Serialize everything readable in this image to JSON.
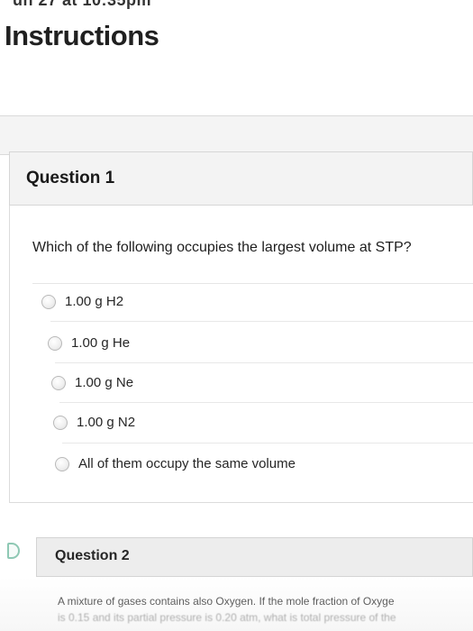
{
  "header": {
    "top_fragment": "un 27 at 10:35pm",
    "title": "Instructions"
  },
  "question1": {
    "title": "Question 1",
    "prompt": "Which of the following occupies the largest volume at STP?",
    "options": [
      {
        "label": "1.00 g H2",
        "selected": false
      },
      {
        "label": "1.00 g He",
        "selected": false
      },
      {
        "label": "1.00 g Ne",
        "selected": false
      },
      {
        "label": "1.00 g N2",
        "selected": false
      },
      {
        "label": "All of them occupy the same volume",
        "selected": false
      }
    ]
  },
  "question2": {
    "title": "Question 2",
    "prompt_line1": "A mixture of gases contains also Oxygen. If the mole fraction of Oxyge",
    "prompt_line2": "is 0.15 and its partial pressure is 0.20 atm, what is total pressure of the"
  },
  "colors": {
    "header_band": "#f3f3f3",
    "border": "#d6d6d6",
    "marker": "#8ec8b4"
  }
}
